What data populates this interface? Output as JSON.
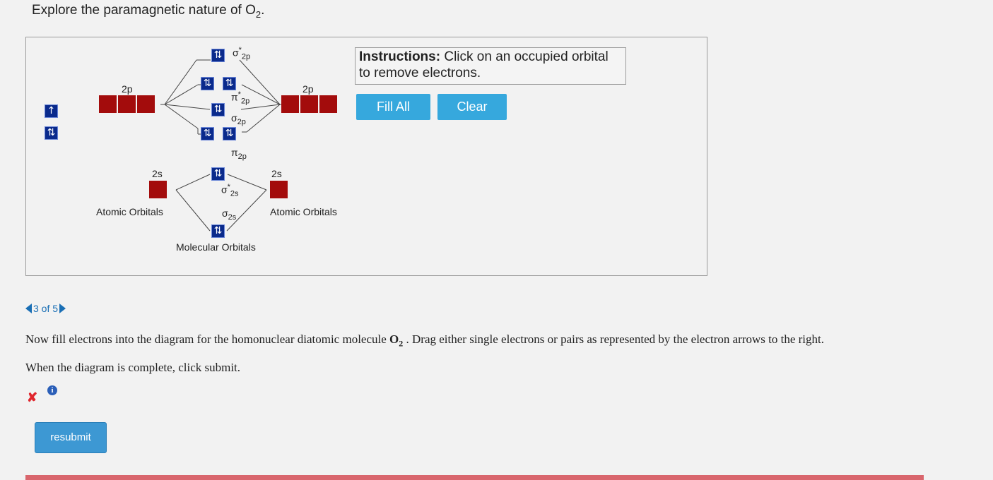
{
  "header": {
    "title_prefix": "Explore the paramagnetic nature of O",
    "title_sub": "2",
    "title_suffix": "."
  },
  "diagram": {
    "labels": {
      "ao_2p": "2p",
      "ao_2s": "2s",
      "ao_left": "Atomic Orbitals",
      "ao_right": "Atomic Orbitals",
      "mo": "Molecular Orbitals"
    },
    "mo_labels": {
      "sigma_star_2p": {
        "base": "σ",
        "sup": "*",
        "sub": "2p"
      },
      "pi_star_2p": {
        "base": "π",
        "sup": "*",
        "sub": "2p"
      },
      "sigma_2p": {
        "base": "σ",
        "sub": "2p"
      },
      "pi_2p": {
        "base": "π",
        "sub": "2p"
      },
      "sigma_star_2s": {
        "base": "σ",
        "sup": "*",
        "sub": "2s"
      },
      "sigma_2s": {
        "base": "σ",
        "sub": "2s"
      }
    },
    "electron_glyphs": {
      "pair": "⇅",
      "single": "↑"
    },
    "colors": {
      "orbital_filled": "#0a2a8c",
      "atomic_orbital": "#a30c0c"
    }
  },
  "instructions": {
    "bold": "Instructions:",
    "text": " Click on an occupied orbital to remove electrons."
  },
  "buttons": {
    "fill_all": "Fill All",
    "clear": "Clear"
  },
  "pager": {
    "text": "3 of 5"
  },
  "question": {
    "line1_prefix": "Now fill electrons into the diagram for the homonuclear diatomic molecule ",
    "molecule": "O",
    "molecule_sub": "2",
    "line1_suffix": " . Drag either single electrons or pairs as represented by the electron arrows to the right.",
    "line2": "When the diagram is complete, click submit."
  },
  "feedback": {
    "incorrect_icon": "✘",
    "info_icon": "i"
  },
  "submit": {
    "label": "resubmit"
  }
}
